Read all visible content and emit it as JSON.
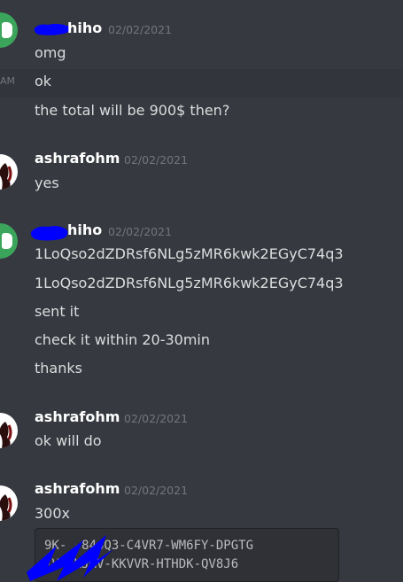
{
  "messages": [
    {
      "author": "hiho",
      "timestamp": "02/02/2021",
      "lines": [
        "omg",
        "ok",
        "the total will be 900$ then?"
      ],
      "side_time": "AM"
    },
    {
      "author": "ashrafohm",
      "timestamp": "02/02/2021",
      "lines": [
        "yes"
      ]
    },
    {
      "author": "hiho",
      "timestamp": "02/02/2021",
      "lines": [
        "1LoQso2dZDRsf6NLg5zMR6kwk2EGyC74q3",
        "1LoQso2dZDRsf6NLg5zMR6kwk2EGyC74q3",
        "sent it",
        "check it within 20-30min",
        "thanks"
      ]
    },
    {
      "author": "ashrafohm",
      "timestamp": "02/02/2021",
      "lines": [
        "ok will do"
      ]
    },
    {
      "author": "ashrafohm",
      "timestamp": "02/02/2021",
      "lines": [
        "300x"
      ],
      "code_lines": [
        "9K-    -844Q3-C4VR7-WM6FY-DPGTG",
        "     -V-GKJMV-KKVVR-HTHDK-QV8J6"
      ]
    }
  ],
  "icons": {
    "bot_avatar": "discord-logo-icon",
    "user_avatar": "ashrafohm-avatar"
  },
  "colors": {
    "background": "#36393f",
    "redaction": "#0000ff",
    "avatar_green": "#3ba55c"
  }
}
